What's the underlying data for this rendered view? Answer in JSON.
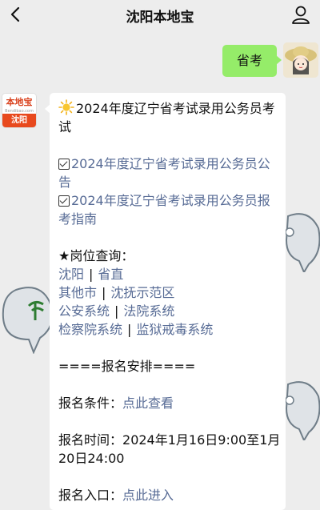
{
  "header": {
    "title": "沈阳本地宝"
  },
  "user_message": {
    "text": "省考"
  },
  "bot": {
    "logo_text": "本地宝",
    "logo_sub": "Bendibao.com",
    "logo_city": "沈阳"
  },
  "message": {
    "heading": "2024年度辽宁省考试录用公务员考试",
    "links": [
      "2024年度辽宁省考试录用公务员公告",
      "2024年度辽宁省考试录用公务员报考指南"
    ],
    "posts_label": "★岗位查询：",
    "posts_rows": [
      [
        "沈阳",
        "省直"
      ],
      [
        "其他市",
        "沈抚示范区"
      ],
      [
        "公安系统",
        "法院系统"
      ],
      [
        "检察院系统",
        "监狱戒毒系统"
      ]
    ],
    "separator": "|",
    "schedule_title": "====报名安排====",
    "conditions_label": "报名条件：",
    "conditions_link": "点此查看",
    "time_label": "报名时间：",
    "time_value": "2024年1月16日9:00至1月20日24:00",
    "entry_label": "报名入口：",
    "entry_link": "点此进入"
  },
  "colors": {
    "user_bubble": "#95ec69",
    "link": "#576b95",
    "background": "#ededed",
    "logo_red": "#e8491d"
  }
}
